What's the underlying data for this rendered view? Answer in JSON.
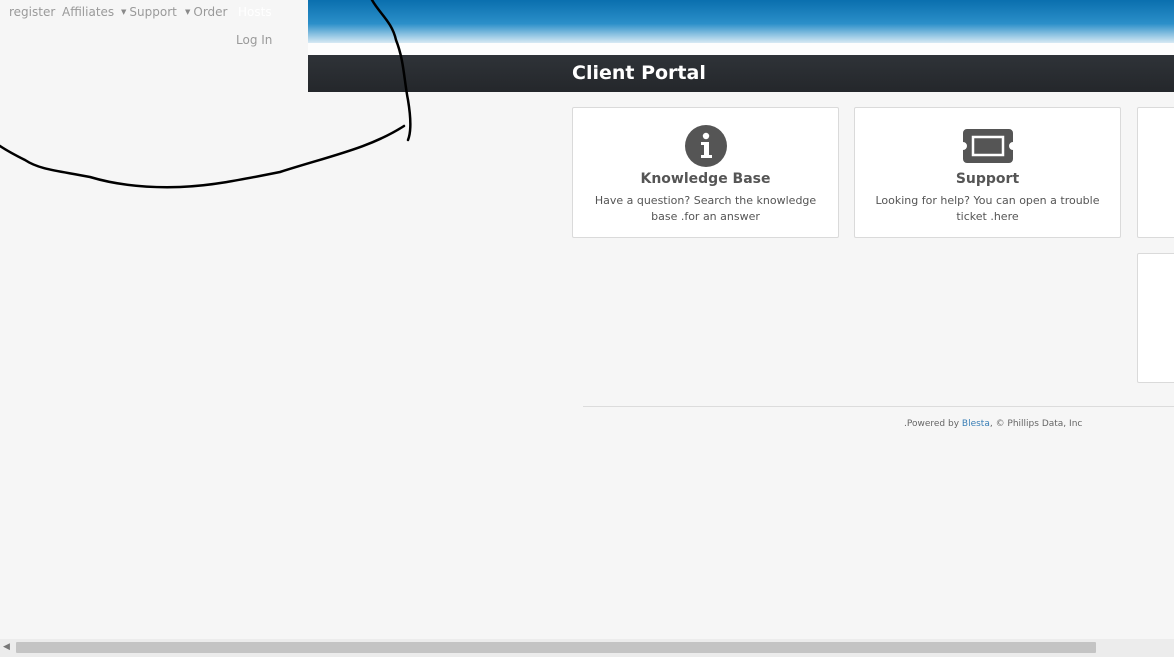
{
  "nav": {
    "register": "register",
    "affiliates": "Affiliates",
    "support": "Support",
    "order": "Order",
    "hosts": "Hosts",
    "login": "Log In"
  },
  "header": {
    "title": "Client Portal"
  },
  "cards": [
    {
      "title": "Knowledge Base",
      "desc": "Have a question? Search the knowledge base .for an answer",
      "icon": "info-icon"
    },
    {
      "title": "Support",
      "desc": "Looking for help? You can open a trouble ticket .here",
      "icon": "ticket-icon"
    }
  ],
  "footer": {
    "prefix": ".Powered by ",
    "link": "Blesta",
    "suffix": ", © Phillips Data, Inc"
  },
  "colors": {
    "header_gradient_top": "#0a6fae",
    "title_bar": "#2a2d31",
    "link": "#3a7fb6",
    "icon": "#555555"
  }
}
